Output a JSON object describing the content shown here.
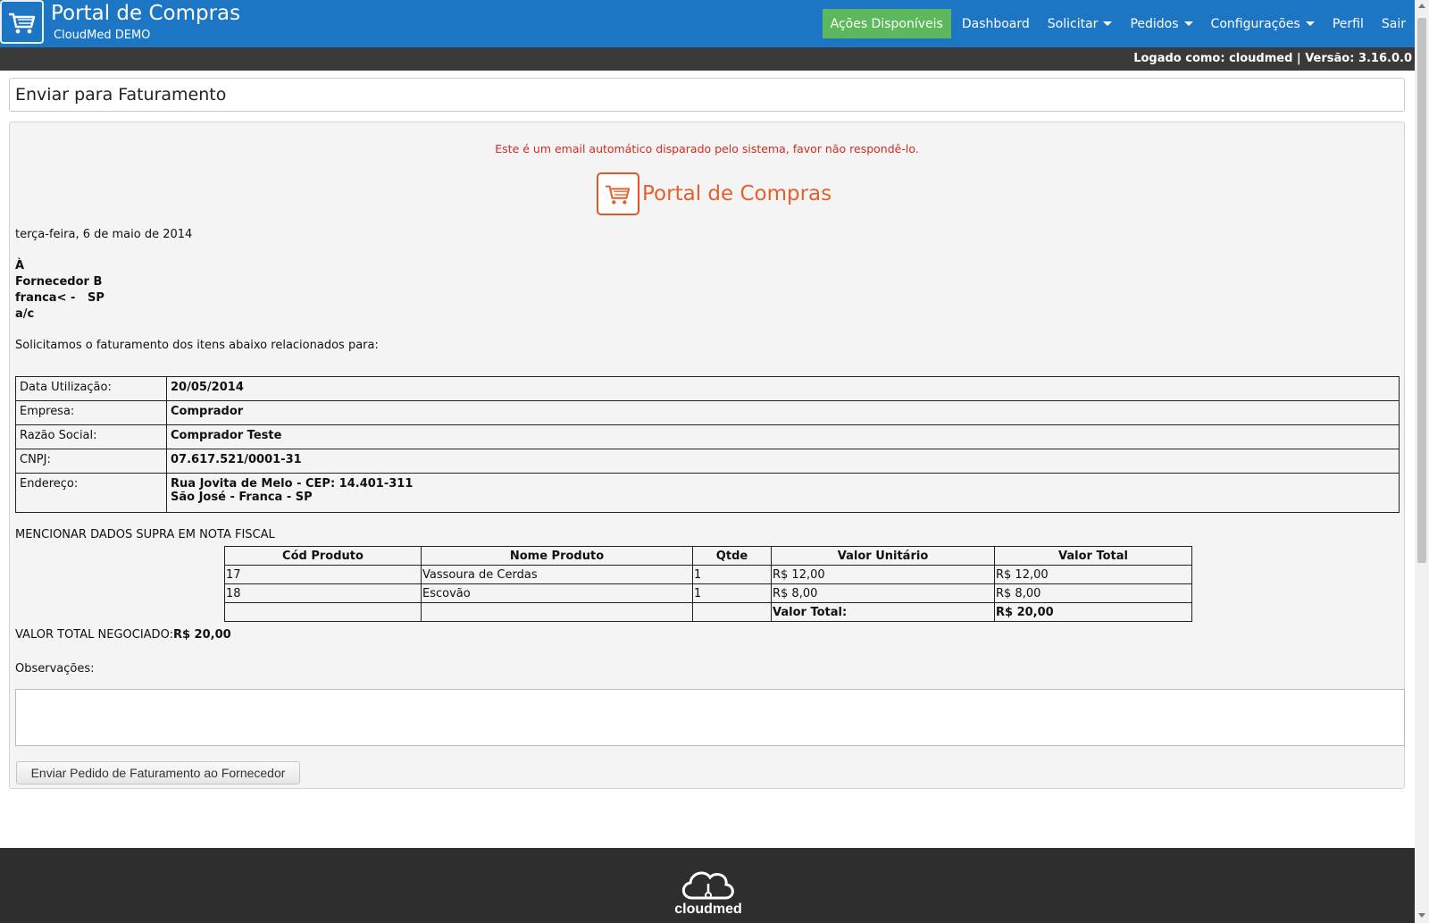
{
  "header": {
    "title": "Portal de Compras",
    "subtitle": "CloudMed DEMO",
    "nav": {
      "actions": "Ações Disponíveis",
      "dashboard": "Dashboard",
      "solicitar": "Solicitar",
      "pedidos": "Pedidos",
      "configuracoes": "Configurações",
      "perfil": "Perfil",
      "sair": "Sair"
    },
    "userbar": "Logado como: cloudmed | Versão: 3.16.0.0"
  },
  "page": {
    "title": "Enviar para Faturamento"
  },
  "email": {
    "notice": "Este é um email automático disparado pelo sistema, favor não respondê-lo.",
    "logo_text": "Portal de Compras",
    "date": "terça-feira, 6 de maio de 2014",
    "address_lines": [
      "À",
      "Fornecedor B",
      "franca< -   SP",
      "a/c"
    ],
    "intro": "Solicitamos o faturamento dos itens abaixo relacionados para:",
    "info": [
      {
        "label": "Data Utilização:",
        "value": "20/05/2014"
      },
      {
        "label": "Empresa:",
        "value": "Comprador"
      },
      {
        "label": "Razão Social:",
        "value": "Comprador Teste"
      },
      {
        "label": "CNPJ:",
        "value": "07.617.521/0001-31"
      },
      {
        "label": "Endereço:",
        "value": "Rua Jovita de Melo - CEP: 14.401-311",
        "value2": "São José - Franca - SP"
      }
    ],
    "mention": "MENCIONAR DADOS SUPRA EM NOTA FISCAL",
    "items_headers": [
      "Cód Produto",
      "Nome Produto",
      "Qtde",
      "Valor Unitário",
      "Valor Total"
    ],
    "items": [
      {
        "code": "17",
        "name": "Vassoura de Cerdas",
        "qty": "1",
        "unit": "R$ 12,00",
        "total": "R$ 12,00"
      },
      {
        "code": "18",
        "name": "Escovão",
        "qty": "1",
        "unit": "R$ 8,00",
        "total": "R$ 8,00"
      }
    ],
    "total_label": "Valor Total:",
    "total_value": "R$ 20,00",
    "negotiated_label": "VALOR TOTAL NEGOCIADO:",
    "negotiated_value": "R$ 20,00",
    "obs_label": "Observações:",
    "obs_value": "",
    "send_button": "Enviar Pedido de Faturamento ao Fornecedor"
  },
  "footer": {
    "brand": "cloudmed"
  },
  "colors": {
    "navbar": "#1c76c4",
    "action_green": "#5cb85c",
    "userbar": "#3a3a3a",
    "notice_red": "#d42a1f",
    "logo_orange": "#e1622e",
    "footer": "#2e2e2e"
  }
}
